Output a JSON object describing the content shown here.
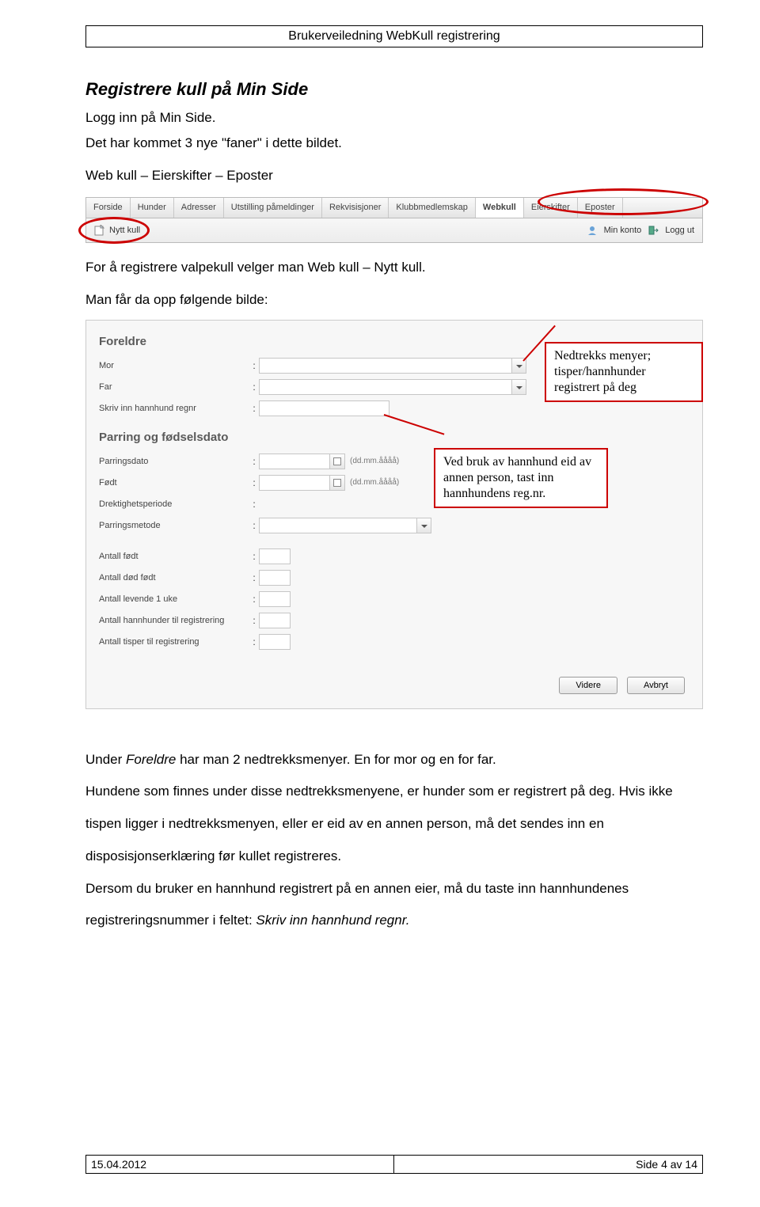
{
  "header": "Brukerveiledning WebKull registrering",
  "title": "Registrere kull på Min Side",
  "intro1": "Logg inn på Min Side.",
  "intro2": "Det har kommet 3 nye \"faner\" i dette bildet.",
  "intro3": "Web kull – Eierskifter – Eposter",
  "tabs": [
    "Forside",
    "Hunder",
    "Adresser",
    "Utstilling påmeldinger",
    "Rekvisisjoner",
    "Klubbmedlemskap",
    "Webkull",
    "Eierskifter",
    "Eposter"
  ],
  "subnav": {
    "nytt": "Nytt kull",
    "minkonto": "Min konto",
    "logout": "Logg ut"
  },
  "after1": "For å registrere valpekull velger man Web kull – Nytt kull.",
  "after2": "Man får da opp følgende bilde:",
  "callout1": "Nedtrekks menyer; tisper/hannhunder registrert på deg",
  "callout2": "Ved bruk av hannhund eid av annen person, tast inn hannhundens reg.nr.",
  "form": {
    "sec1": "Foreldre",
    "mor": "Mor",
    "far": "Far",
    "skriv": "Skriv inn hannhund regnr",
    "sec2": "Parring og fødselsdato",
    "parringsdato": "Parringsdato",
    "datehint": "(dd.mm.åååå)",
    "fodt": "Født",
    "drekt": "Drektighetsperiode",
    "metode": "Parringsmetode",
    "af": "Antall født",
    "adf": "Antall død født",
    "al1": "Antall levende 1 uke",
    "ahr": "Antall hannhunder til registrering",
    "atr": "Antall tisper til registrering",
    "videre": "Videre",
    "avbryt": "Avbryt"
  },
  "para1a": "Under ",
  "para1b": "Foreldre",
  "para1c": " har man 2 nedtrekksmenyer. En for mor og en for far.",
  "para2": "Hundene som finnes under disse nedtrekksmenyene, er hunder som er registrert på deg. Hvis ikke tispen ligger i nedtrekksmenyen, eller er eid av en annen person, må det sendes inn en disposisjonserklæring før kullet registreres.",
  "para3a": "Dersom du bruker en hannhund registrert på en annen eier, må du taste inn hannhundenes registreringsnummer i feltet: ",
  "para3b": "Skriv inn hannhund regnr.",
  "footer": {
    "date": "15.04.2012",
    "page": "Side 4 av 14"
  }
}
